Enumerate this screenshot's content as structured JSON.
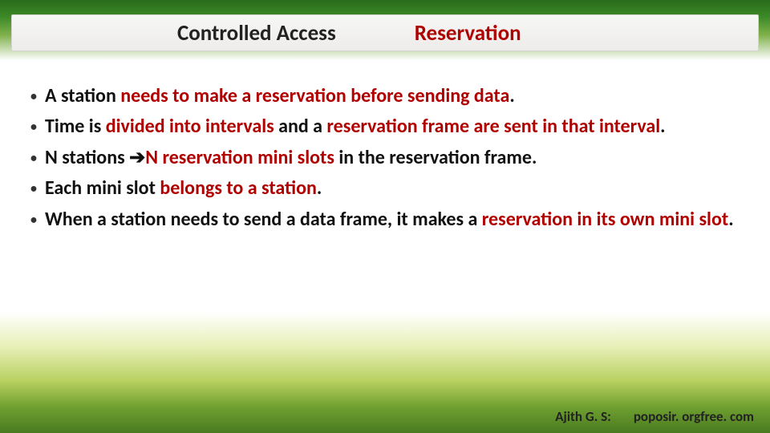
{
  "title": {
    "main": "Controlled Access",
    "sub": "Reservation"
  },
  "bullets": [
    {
      "pre": "A station ",
      "red1": "needs to make a reservation before sending data",
      "mid": "",
      "red2": "",
      "post": "."
    },
    {
      "pre": "Time is ",
      "red1": "divided into intervals ",
      "mid": "and a ",
      "red2": "reservation frame are sent in that interval",
      "post": "."
    },
    {
      "pre": "N stations ",
      "red1": "",
      "arrow": "➔",
      "mid": "",
      "red2": "N reservation mini slots ",
      "post": "in the reservation frame."
    },
    {
      "pre": "Each mini slot ",
      "red1": "belongs to a station",
      "mid": "",
      "red2": "",
      "post": "."
    },
    {
      "pre": "When a station needs to send a data frame, it makes a ",
      "red1": "reservation in its own mini slot",
      "mid": "",
      "red2": "",
      "post": "."
    }
  ],
  "footer": {
    "author": "Ajith G. S:",
    "site": "poposir. orgfree. com"
  }
}
